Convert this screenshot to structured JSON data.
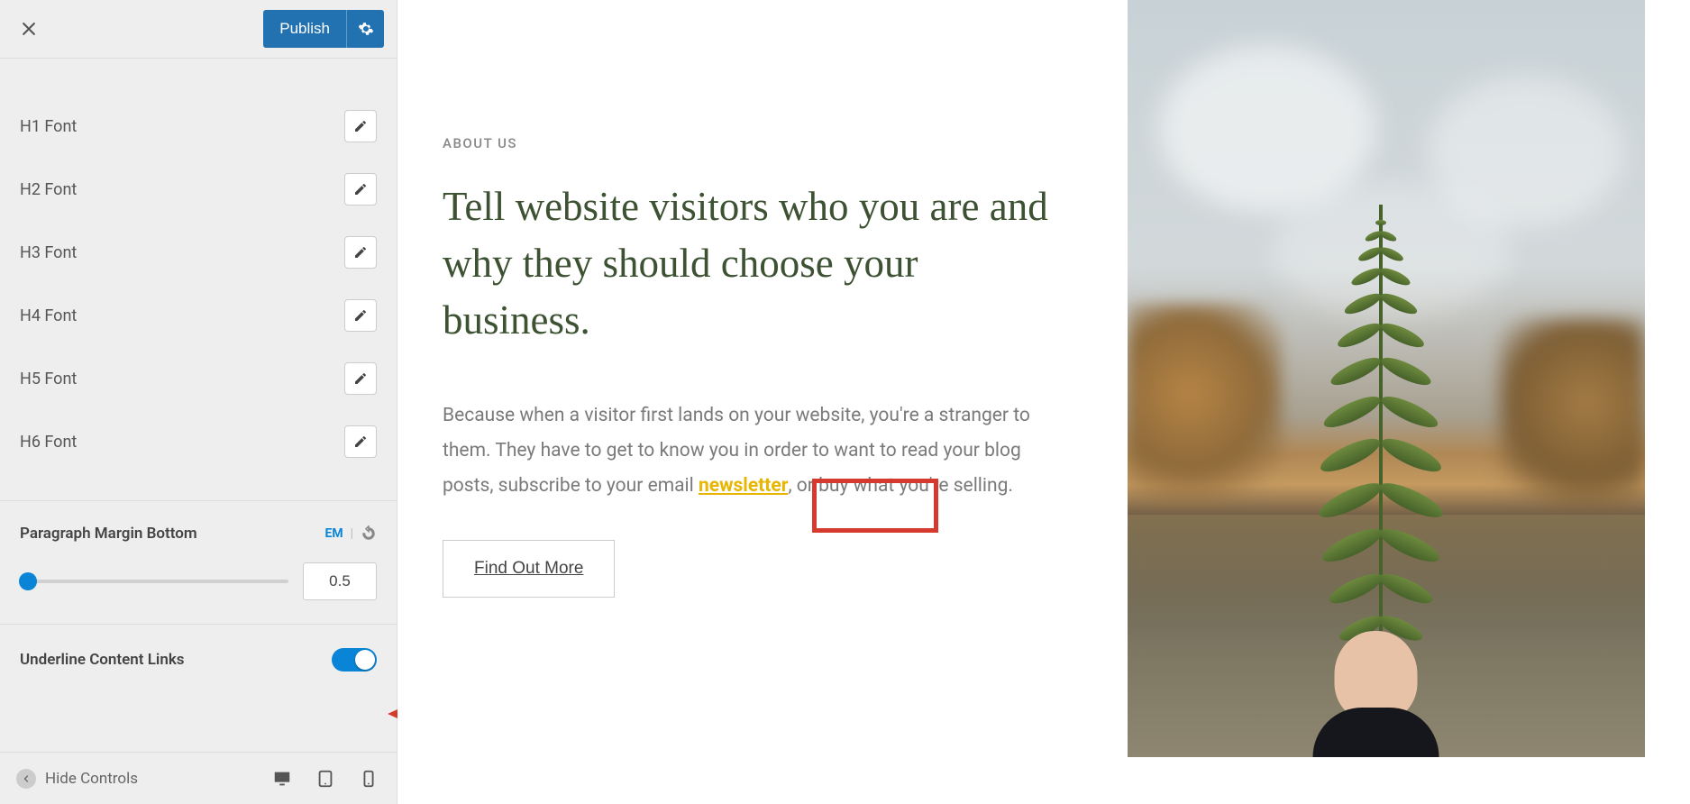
{
  "sidebar": {
    "publish_label": "Publish",
    "font_items": [
      {
        "label": "H1 Font"
      },
      {
        "label": "H2 Font"
      },
      {
        "label": "H3 Font"
      },
      {
        "label": "H4 Font"
      },
      {
        "label": "H5 Font"
      },
      {
        "label": "H6 Font"
      }
    ],
    "paragraph_margin": {
      "title": "Paragraph Margin Bottom",
      "unit": "EM",
      "value": "0.5"
    },
    "underline": {
      "title": "Underline Content Links",
      "enabled": true
    },
    "footer": {
      "hide_label": "Hide Controls"
    }
  },
  "preview": {
    "eyebrow": "ABOUT US",
    "headline": "Tell website visitors who you are and why they should choose your business.",
    "paragraph_before_link": "Because when a visitor first lands on your website, you're a stranger to them. They have to get to know you in order to want to read your blog posts, subscribe to your email ",
    "link_text": "newsletter",
    "paragraph_after_link": ", or buy what you're selling.",
    "cta_label": "Find Out More"
  },
  "colors": {
    "accent": "#2271b1",
    "headline": "#3d5232",
    "link": "#e8b500",
    "annotation": "#d63a2f"
  }
}
